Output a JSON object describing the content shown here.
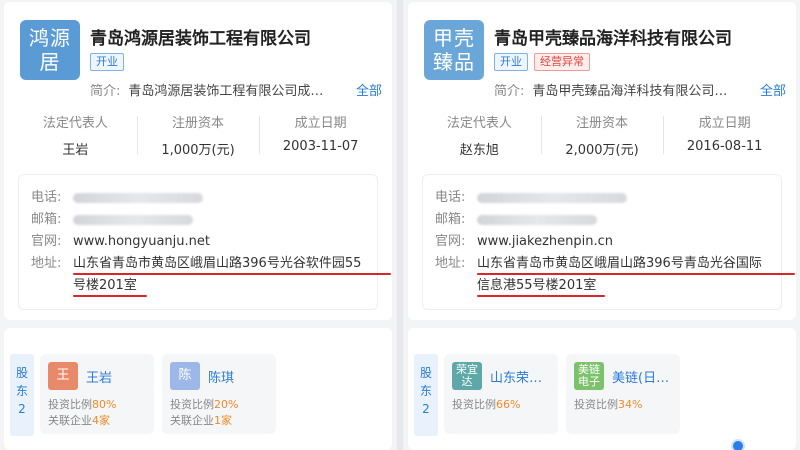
{
  "left": {
    "logo_text": "鸿源居",
    "logo_color": "#5b9bd5",
    "company_name": "青岛鸿源居装饰工程有限公司",
    "badges": [
      {
        "text": "开业",
        "type": "blue"
      }
    ],
    "intro_label": "简介:",
    "intro_text": "青岛鸿源居装饰工程有限公司成…",
    "more": "全部",
    "stats": [
      {
        "k": "法定代表人",
        "v": "王岩"
      },
      {
        "k": "注册资本",
        "v": "1,000万(元)"
      },
      {
        "k": "成立日期",
        "v": "2003-11-07"
      }
    ],
    "contact": {
      "phone_label": "电话:",
      "email_label": "邮箱:",
      "website_label": "官网:",
      "website": "www.hongyuanju.net",
      "address_label": "地址:",
      "address_line1": "山东省青岛市黄岛区峨眉山路396号光谷软件园55",
      "address_line2": "号楼201室"
    },
    "shareholder_tag": "股东",
    "shareholder_count": "2",
    "shareholders": [
      {
        "avatar": "王",
        "avatar_color": "#e8896a",
        "name": "王岩",
        "ratio_label": "投资比例",
        "ratio": "80%",
        "rel_label": "关联企业",
        "rel": "4家"
      },
      {
        "avatar": "陈",
        "avatar_color": "#9db8e8",
        "name": "陈琪",
        "ratio_label": "投资比例",
        "ratio": "20%",
        "rel_label": "关联企业",
        "rel": "1家"
      }
    ]
  },
  "right": {
    "logo_text": "甲壳臻品",
    "logo_color": "#6aa7d8",
    "company_name": "青岛甲壳臻品海洋科技有限公司",
    "badges": [
      {
        "text": "开业",
        "type": "blue"
      },
      {
        "text": "经营异常",
        "type": "red"
      }
    ],
    "intro_label": "简介:",
    "intro_text": "青岛甲壳臻品海洋科技有限公司…",
    "more": "全部",
    "stats": [
      {
        "k": "法定代表人",
        "v": "赵东旭"
      },
      {
        "k": "注册资本",
        "v": "2,000万(元)"
      },
      {
        "k": "成立日期",
        "v": "2016-08-11"
      }
    ],
    "contact": {
      "phone_label": "电话:",
      "email_label": "邮箱:",
      "website_label": "官网:",
      "website": "www.jiakezhenpin.cn",
      "address_label": "地址:",
      "address_line1": "山东省青岛市黄岛区峨眉山路396号青岛光谷国际",
      "address_line2": "信息港55号楼201室"
    },
    "shareholder_tag": "股东",
    "shareholder_count": "2",
    "shareholders": [
      {
        "avatar": "荣宜达",
        "avatar_color": "#5fa8a8",
        "name": "山东荣…",
        "ratio_label": "投资比例",
        "ratio": "66%"
      },
      {
        "avatar": "美链电子",
        "avatar_color": "#7cc26b",
        "name": "美链(日…",
        "ratio_label": "投资比例",
        "ratio": "34%"
      }
    ]
  }
}
